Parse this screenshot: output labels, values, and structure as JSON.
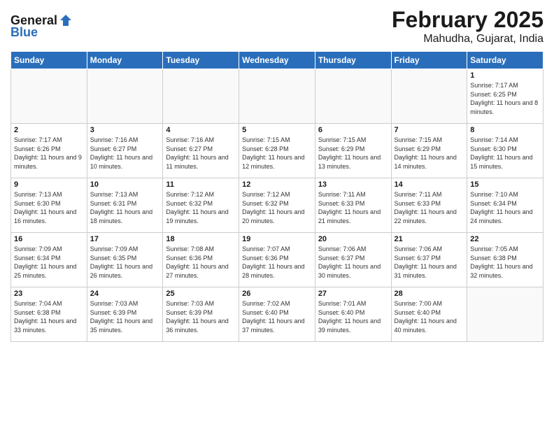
{
  "logo": {
    "general": "General",
    "blue": "Blue"
  },
  "title": "February 2025",
  "subtitle": "Mahudha, Gujarat, India",
  "days_of_week": [
    "Sunday",
    "Monday",
    "Tuesday",
    "Wednesday",
    "Thursday",
    "Friday",
    "Saturday"
  ],
  "weeks": [
    [
      {
        "day": "",
        "info": ""
      },
      {
        "day": "",
        "info": ""
      },
      {
        "day": "",
        "info": ""
      },
      {
        "day": "",
        "info": ""
      },
      {
        "day": "",
        "info": ""
      },
      {
        "day": "",
        "info": ""
      },
      {
        "day": "1",
        "info": "Sunrise: 7:17 AM\nSunset: 6:25 PM\nDaylight: 11 hours and 8 minutes."
      }
    ],
    [
      {
        "day": "2",
        "info": "Sunrise: 7:17 AM\nSunset: 6:26 PM\nDaylight: 11 hours and 9 minutes."
      },
      {
        "day": "3",
        "info": "Sunrise: 7:16 AM\nSunset: 6:27 PM\nDaylight: 11 hours and 10 minutes."
      },
      {
        "day": "4",
        "info": "Sunrise: 7:16 AM\nSunset: 6:27 PM\nDaylight: 11 hours and 11 minutes."
      },
      {
        "day": "5",
        "info": "Sunrise: 7:15 AM\nSunset: 6:28 PM\nDaylight: 11 hours and 12 minutes."
      },
      {
        "day": "6",
        "info": "Sunrise: 7:15 AM\nSunset: 6:29 PM\nDaylight: 11 hours and 13 minutes."
      },
      {
        "day": "7",
        "info": "Sunrise: 7:15 AM\nSunset: 6:29 PM\nDaylight: 11 hours and 14 minutes."
      },
      {
        "day": "8",
        "info": "Sunrise: 7:14 AM\nSunset: 6:30 PM\nDaylight: 11 hours and 15 minutes."
      }
    ],
    [
      {
        "day": "9",
        "info": "Sunrise: 7:13 AM\nSunset: 6:30 PM\nDaylight: 11 hours and 16 minutes."
      },
      {
        "day": "10",
        "info": "Sunrise: 7:13 AM\nSunset: 6:31 PM\nDaylight: 11 hours and 18 minutes."
      },
      {
        "day": "11",
        "info": "Sunrise: 7:12 AM\nSunset: 6:32 PM\nDaylight: 11 hours and 19 minutes."
      },
      {
        "day": "12",
        "info": "Sunrise: 7:12 AM\nSunset: 6:32 PM\nDaylight: 11 hours and 20 minutes."
      },
      {
        "day": "13",
        "info": "Sunrise: 7:11 AM\nSunset: 6:33 PM\nDaylight: 11 hours and 21 minutes."
      },
      {
        "day": "14",
        "info": "Sunrise: 7:11 AM\nSunset: 6:33 PM\nDaylight: 11 hours and 22 minutes."
      },
      {
        "day": "15",
        "info": "Sunrise: 7:10 AM\nSunset: 6:34 PM\nDaylight: 11 hours and 24 minutes."
      }
    ],
    [
      {
        "day": "16",
        "info": "Sunrise: 7:09 AM\nSunset: 6:34 PM\nDaylight: 11 hours and 25 minutes."
      },
      {
        "day": "17",
        "info": "Sunrise: 7:09 AM\nSunset: 6:35 PM\nDaylight: 11 hours and 26 minutes."
      },
      {
        "day": "18",
        "info": "Sunrise: 7:08 AM\nSunset: 6:36 PM\nDaylight: 11 hours and 27 minutes."
      },
      {
        "day": "19",
        "info": "Sunrise: 7:07 AM\nSunset: 6:36 PM\nDaylight: 11 hours and 28 minutes."
      },
      {
        "day": "20",
        "info": "Sunrise: 7:06 AM\nSunset: 6:37 PM\nDaylight: 11 hours and 30 minutes."
      },
      {
        "day": "21",
        "info": "Sunrise: 7:06 AM\nSunset: 6:37 PM\nDaylight: 11 hours and 31 minutes."
      },
      {
        "day": "22",
        "info": "Sunrise: 7:05 AM\nSunset: 6:38 PM\nDaylight: 11 hours and 32 minutes."
      }
    ],
    [
      {
        "day": "23",
        "info": "Sunrise: 7:04 AM\nSunset: 6:38 PM\nDaylight: 11 hours and 33 minutes."
      },
      {
        "day": "24",
        "info": "Sunrise: 7:03 AM\nSunset: 6:39 PM\nDaylight: 11 hours and 35 minutes."
      },
      {
        "day": "25",
        "info": "Sunrise: 7:03 AM\nSunset: 6:39 PM\nDaylight: 11 hours and 36 minutes."
      },
      {
        "day": "26",
        "info": "Sunrise: 7:02 AM\nSunset: 6:40 PM\nDaylight: 11 hours and 37 minutes."
      },
      {
        "day": "27",
        "info": "Sunrise: 7:01 AM\nSunset: 6:40 PM\nDaylight: 11 hours and 39 minutes."
      },
      {
        "day": "28",
        "info": "Sunrise: 7:00 AM\nSunset: 6:40 PM\nDaylight: 11 hours and 40 minutes."
      },
      {
        "day": "",
        "info": ""
      }
    ]
  ]
}
